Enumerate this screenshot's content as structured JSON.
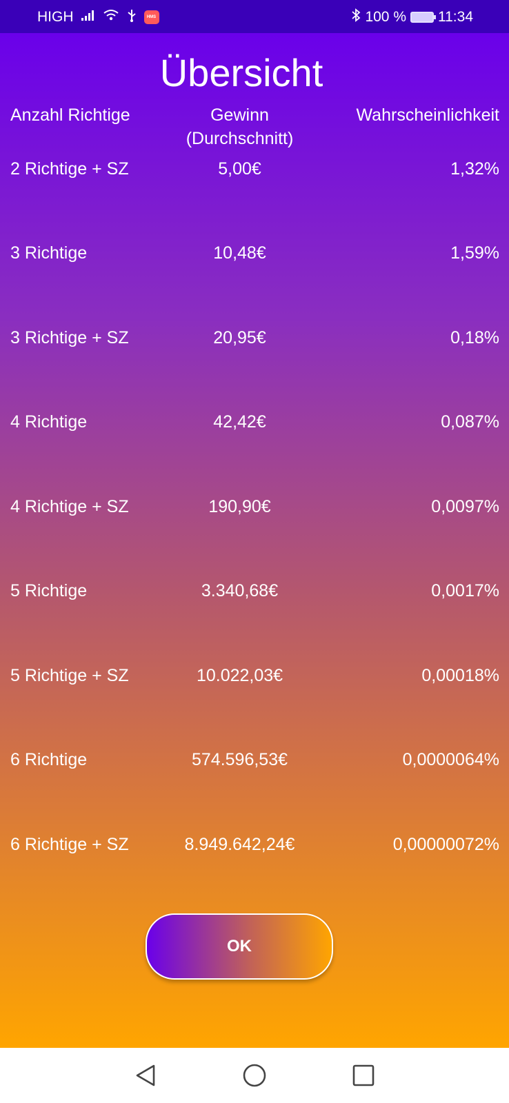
{
  "status_bar": {
    "network": "HIGH",
    "battery": "100 %",
    "time": "11:34",
    "hms_badge": "HMS",
    "icons": [
      "signal-icon",
      "wifi-icon",
      "usb-icon",
      "hms-icon",
      "bluetooth-icon",
      "battery-icon"
    ]
  },
  "screen": {
    "title": "Übersicht",
    "headers": {
      "count": "Anzahl Richtige",
      "prize_line1": "Gewinn",
      "prize_line2": "(Durchschnitt)",
      "probability": "Wahrscheinlichkeit"
    },
    "rows": [
      {
        "count": "2 Richtige + SZ",
        "prize": "5,00€",
        "probability": "1,32%"
      },
      {
        "count": "3 Richtige",
        "prize": "10,48€",
        "probability": "1,59%"
      },
      {
        "count": "3 Richtige + SZ",
        "prize": "20,95€",
        "probability": "0,18%"
      },
      {
        "count": "4 Richtige",
        "prize": "42,42€",
        "probability": "0,087%"
      },
      {
        "count": "4 Richtige + SZ",
        "prize": "190,90€",
        "probability": "0,0097%"
      },
      {
        "count": "5 Richtige",
        "prize": "3.340,68€",
        "probability": "0,0017%"
      },
      {
        "count": "5 Richtige + SZ",
        "prize": "10.022,03€",
        "probability": "0,00018%"
      },
      {
        "count": "6 Richtige",
        "prize": "574.596,53€",
        "probability": "0,0000064%"
      },
      {
        "count": "6 Richtige + SZ",
        "prize": "8.949.642,24€",
        "probability": "0,00000072%"
      }
    ],
    "ok_label": "OK"
  },
  "colors": {
    "gradient_top": "#6a00ea",
    "gradient_bottom": "#ffa500",
    "status_bar": "#3a00b8"
  },
  "nav_bar": {
    "icons": [
      "back-icon",
      "home-icon",
      "recents-icon"
    ]
  }
}
